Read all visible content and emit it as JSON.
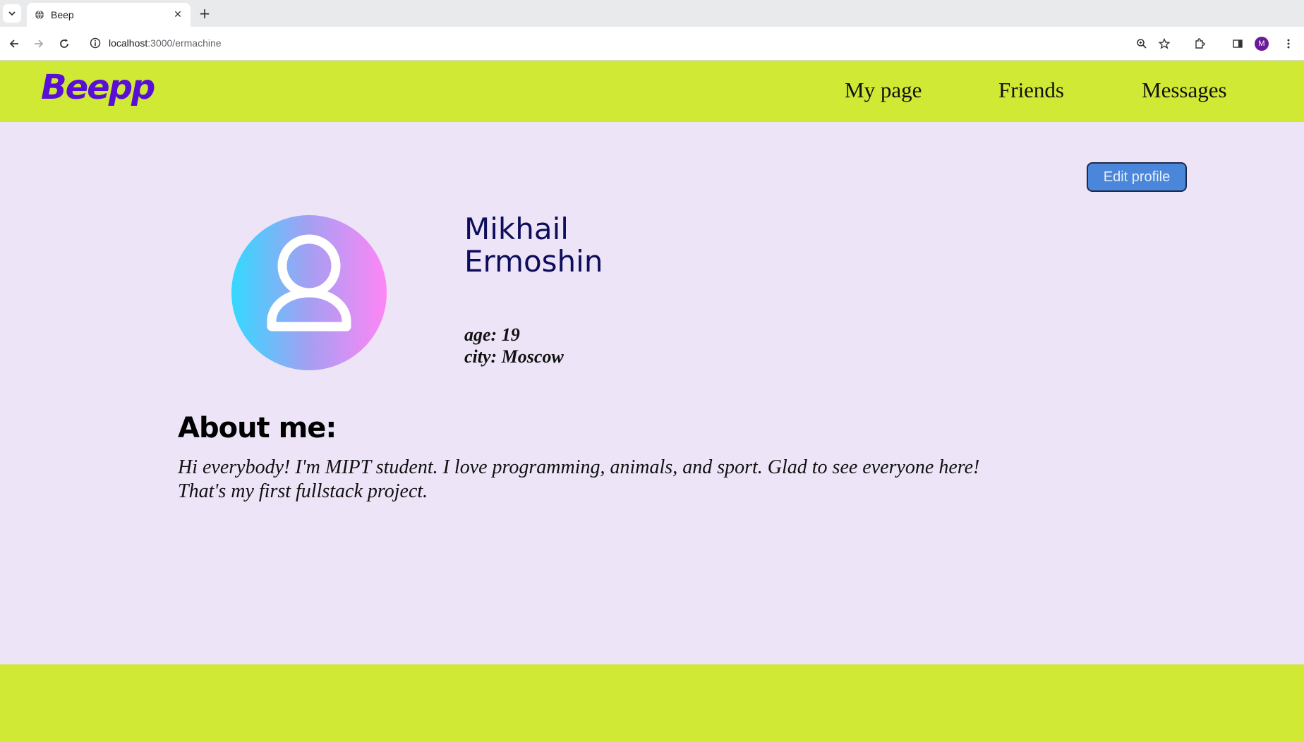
{
  "browser": {
    "tab_title": "Beep",
    "url_host": "localhost",
    "url_path": ":3000/ermachine",
    "profile_initial": "M",
    "icons": [
      "tab-list-icon",
      "globe-icon",
      "close-icon",
      "plus-icon",
      "back-icon",
      "forward-icon",
      "reload-icon",
      "info-icon",
      "zoom-icon",
      "star-icon",
      "extensions-icon",
      "sidepanel-icon",
      "menu-icon"
    ]
  },
  "site": {
    "logo": "Beepp",
    "nav": {
      "my_page": "My page",
      "friends": "Friends",
      "messages": "Messages"
    },
    "colors": {
      "header": "#cfe935",
      "background": "#ede4f7",
      "logo": "#5a0fd6",
      "button": "#4a86d9"
    }
  },
  "profile": {
    "edit_label": "Edit profile",
    "first_name": "Mikhail",
    "last_name": "Ermoshin",
    "age": "age: 19",
    "city": "city: Moscow",
    "about_title": "About me:",
    "about_text": "Hi everybody! I'm MIPT student. I love programming, animals, and sport. Glad to see everyone here! That's my first fullstack project.",
    "avatar_icon": "user-icon"
  }
}
